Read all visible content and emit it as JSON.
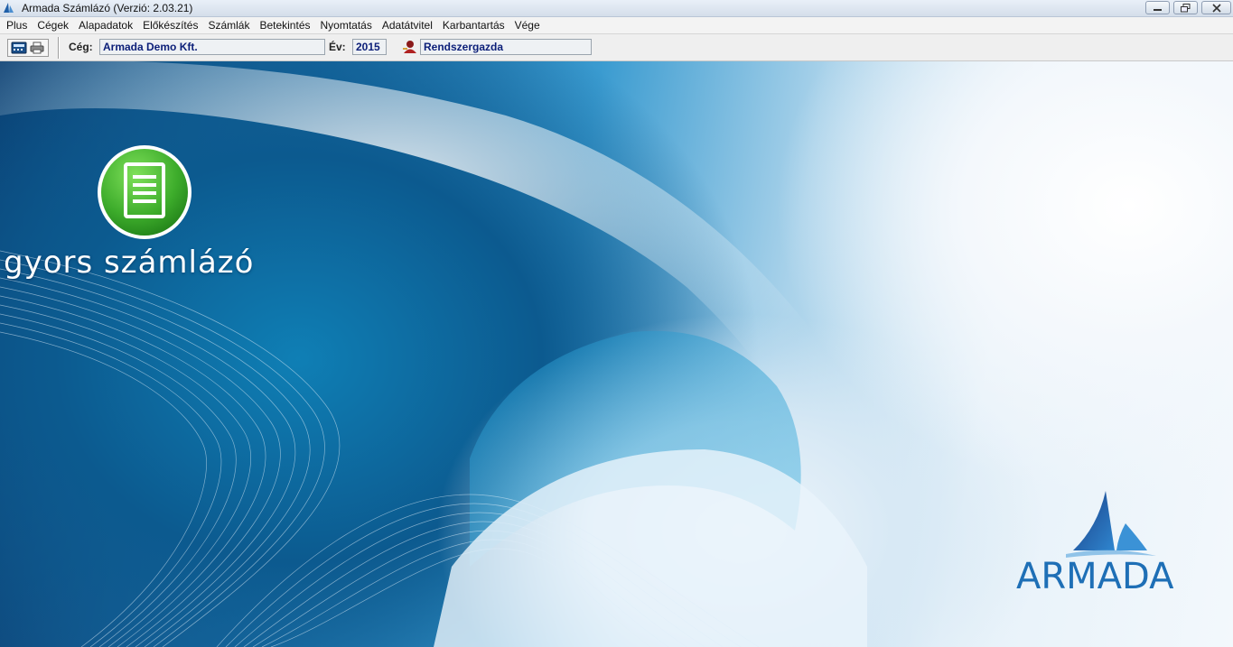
{
  "window": {
    "title": "Armada Számlázó (Verzió: 2.03.21)",
    "icon": "armada-sail-icon"
  },
  "menu": [
    {
      "label": "Plus"
    },
    {
      "label": "Cégek"
    },
    {
      "label": "Alapadatok"
    },
    {
      "label": "Előkészítés"
    },
    {
      "label": "Számlák"
    },
    {
      "label": "Betekintés"
    },
    {
      "label": "Nyomtatás"
    },
    {
      "label": "Adatátvitel"
    },
    {
      "label": "Karbantartás"
    },
    {
      "label": "Vége"
    }
  ],
  "toolbar": {
    "company_label": "Cég:",
    "company_value": "Armada Demo Kft.",
    "year_label": "Év:",
    "year_value": "2015",
    "user_value": "Rendszergazda"
  },
  "desktop": {
    "brand_text": "gyors számlázó",
    "logo_text": "ARMADA",
    "colors": {
      "logo_blue": "#1e6fb6",
      "icon_green": "#3dac2b"
    }
  }
}
